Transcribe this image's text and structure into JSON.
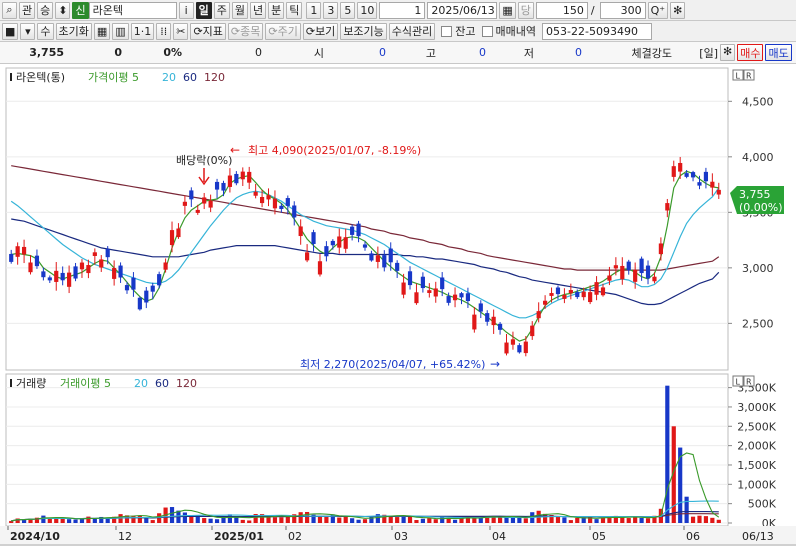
{
  "toolbar1": {
    "search_glyph": "⌕",
    "tab_gwan": "관",
    "tab_seung": "승",
    "spin_glyph": "⬍",
    "stock_prefix": "신",
    "stock_name": "라온텍",
    "info_glyph": "i",
    "period_tabs": [
      "일",
      "주",
      "월",
      "년",
      "분",
      "틱"
    ],
    "period_selected": "일",
    "multiples": [
      "1",
      "3",
      "5",
      "10"
    ],
    "multiple_value": "1",
    "date": "2025/06/13",
    "calendar_glyph": "▦",
    "dang": "당",
    "count": "150",
    "slash": "/",
    "max_count": "300",
    "zoom_glyph": "Q⁺",
    "gear_glyph": "✻"
  },
  "toolbar2": {
    "stop_glyph": "■",
    "drop_glyph": "▾",
    "su": "수",
    "reset": "초기화",
    "grid_glyph": "▦",
    "split_glyph": "▥",
    "oneone": "1·1",
    "candle_glyph": "⁞⁞",
    "cross_glyph": "✂",
    "indicator": "지표",
    "item": "종목",
    "period": "주기",
    "view": "보기",
    "aux": "보조기능",
    "formula": "수식관리",
    "balance": "잔고",
    "trades": "매매내역",
    "phone": "053-22-5093490",
    "refresh_glyph": "⟳"
  },
  "quote": {
    "price": "3,755",
    "change": "0",
    "rate": "0%",
    "volume": "0",
    "open_label": "시",
    "open": "0",
    "high_label": "고",
    "high": "0",
    "low_label": "저",
    "low": "0",
    "strength_label": "체결강도",
    "unit": "[일]",
    "buy": "매수",
    "sell": "매도",
    "gear_glyph": "✻"
  },
  "chart_data": [
    {
      "type": "candlestick",
      "title": "라온텍(통)",
      "legend": [
        {
          "name": "가격이평 5",
          "color": "#3a9a2a"
        },
        {
          "name": "20",
          "color": "#36b4d8"
        },
        {
          "name": "60",
          "color": "#1a2a80"
        },
        {
          "name": "120",
          "color": "#7a2838"
        }
      ],
      "up_color": "#e01818",
      "down_color": "#1838c8",
      "ylim": [
        2080,
        4800
      ],
      "y_ticks": [
        "2,500",
        "3,000",
        "3,500",
        "4,000",
        "4,500"
      ],
      "x_labels": [
        "2024/10",
        "12",
        "2025/01",
        "02",
        "03",
        "04",
        "05",
        "06",
        "06/13"
      ],
      "annotations": {
        "high": "최고 4,090(2025/01/07, -8.19%)",
        "low": "최저 2,270(2025/04/07, +65.42%)",
        "dividend": "배당락(0%)",
        "arrow_left": "←",
        "arrow_right": "→"
      },
      "last_price_label": "3,755",
      "last_rate_label": "(0.00%)",
      "icon_lock": "L",
      "icon_right": "R",
      "ma5": [
        3120,
        3130,
        3120,
        3110,
        3080,
        3000,
        2960,
        2920,
        2900,
        2920,
        2940,
        2960,
        3000,
        3040,
        3070,
        3060,
        3000,
        2940,
        2870,
        2800,
        2740,
        2700,
        2720,
        2820,
        2990,
        3180,
        3330,
        3450,
        3520,
        3560,
        3600,
        3610,
        3620,
        3660,
        3760,
        3800,
        3820,
        3830,
        3770,
        3700,
        3650,
        3620,
        3580,
        3520,
        3440,
        3350,
        3260,
        3200,
        3150,
        3120,
        3180,
        3230,
        3270,
        3280,
        3270,
        3240,
        3180,
        3120,
        3060,
        3010,
        2960,
        2920,
        2880,
        2860,
        2840,
        2820,
        2800,
        2780,
        2750,
        2730,
        2710,
        2680,
        2640,
        2600,
        2560,
        2510,
        2470,
        2420,
        2380,
        2340,
        2360,
        2450,
        2560,
        2660,
        2710,
        2740,
        2760,
        2770,
        2790,
        2810,
        2830,
        2850,
        2880,
        2920,
        2960,
        2990,
        2990,
        2960,
        2920,
        2900,
        2950,
        3100,
        3380,
        3720,
        3830,
        3870,
        3850,
        3800,
        3760,
        3730,
        3720
      ],
      "ma20": [
        3600,
        3560,
        3510,
        3460,
        3410,
        3360,
        3310,
        3260,
        3210,
        3170,
        3130,
        3090,
        3060,
        3030,
        3010,
        2990,
        2970,
        2950,
        2930,
        2910,
        2890,
        2870,
        2860,
        2860,
        2880,
        2920,
        2980,
        3060,
        3140,
        3220,
        3300,
        3380,
        3450,
        3520,
        3580,
        3630,
        3660,
        3680,
        3690,
        3680,
        3660,
        3630,
        3600,
        3560,
        3520,
        3480,
        3450,
        3420,
        3400,
        3380,
        3370,
        3360,
        3350,
        3340,
        3320,
        3300,
        3270,
        3240,
        3210,
        3170,
        3130,
        3090,
        3050,
        3020,
        2990,
        2960,
        2930,
        2900,
        2870,
        2840,
        2810,
        2780,
        2750,
        2720,
        2690,
        2660,
        2630,
        2600,
        2570,
        2550,
        2550,
        2570,
        2600,
        2640,
        2680,
        2710,
        2730,
        2750,
        2770,
        2790,
        2810,
        2830,
        2850,
        2870,
        2890,
        2900,
        2890,
        2860,
        2830,
        2830,
        2850,
        2900,
        3000,
        3140,
        3280,
        3400,
        3480,
        3540,
        3590,
        3640,
        3720
      ],
      "ma60": [
        3440,
        3430,
        3420,
        3400,
        3380,
        3360,
        3340,
        3320,
        3300,
        3280,
        3260,
        3240,
        3220,
        3200,
        3180,
        3170,
        3160,
        3150,
        3140,
        3130,
        3120,
        3110,
        3100,
        3100,
        3100,
        3100,
        3100,
        3110,
        3120,
        3130,
        3140,
        3160,
        3170,
        3180,
        3190,
        3200,
        3200,
        3200,
        3200,
        3200,
        3200,
        3200,
        3190,
        3180,
        3170,
        3160,
        3150,
        3140,
        3130,
        3130,
        3130,
        3120,
        3120,
        3120,
        3120,
        3120,
        3120,
        3120,
        3120,
        3120,
        3120,
        3110,
        3110,
        3100,
        3100,
        3090,
        3080,
        3080,
        3070,
        3060,
        3050,
        3040,
        3030,
        3010,
        3000,
        2990,
        2970,
        2960,
        2940,
        2920,
        2910,
        2890,
        2880,
        2870,
        2860,
        2850,
        2840,
        2830,
        2820,
        2810,
        2800,
        2790,
        2780,
        2770,
        2760,
        2740,
        2720,
        2700,
        2680,
        2670,
        2670,
        2680,
        2710,
        2740,
        2770,
        2800,
        2830,
        2860,
        2880,
        2900,
        2960
      ],
      "ma120": [
        3920,
        3910,
        3900,
        3890,
        3880,
        3870,
        3860,
        3850,
        3840,
        3830,
        3820,
        3810,
        3800,
        3790,
        3780,
        3770,
        3760,
        3750,
        3740,
        3730,
        3720,
        3710,
        3700,
        3690,
        3680,
        3670,
        3660,
        3650,
        3640,
        3630,
        3620,
        3610,
        3600,
        3590,
        3580,
        3570,
        3560,
        3550,
        3540,
        3530,
        3520,
        3510,
        3500,
        3490,
        3480,
        3470,
        3460,
        3450,
        3440,
        3430,
        3420,
        3410,
        3400,
        3390,
        3380,
        3370,
        3350,
        3340,
        3330,
        3310,
        3300,
        3290,
        3270,
        3260,
        3250,
        3230,
        3220,
        3210,
        3190,
        3180,
        3170,
        3150,
        3140,
        3130,
        3110,
        3100,
        3090,
        3080,
        3070,
        3060,
        3050,
        3040,
        3030,
        3020,
        3010,
        3000,
        2990,
        2990,
        2980,
        2980,
        2980,
        2980,
        2980,
        2980,
        2980,
        2980,
        2980,
        2980,
        2980,
        2980,
        2980,
        2980,
        2990,
        3000,
        3010,
        3020,
        3030,
        3040,
        3050,
        3060,
        3100
      ]
    },
    {
      "type": "bar",
      "title": "거래량",
      "legend": [
        {
          "name": "거래이평 5",
          "color": "#3a9a2a"
        },
        {
          "name": "20",
          "color": "#36b4d8"
        },
        {
          "name": "60",
          "color": "#1a2a80"
        },
        {
          "name": "120",
          "color": "#7a2838"
        }
      ],
      "ylim": [
        0,
        3800000
      ],
      "y_ticks": [
        "0K",
        "500K",
        "1,000K",
        "1,500K",
        "2,000K",
        "2,500K",
        "3,000K",
        "3,500K"
      ],
      "icon_lock": "L",
      "icon_right": "R"
    }
  ]
}
